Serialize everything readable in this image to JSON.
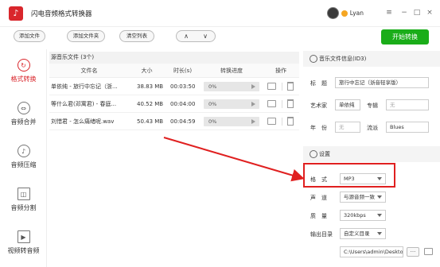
{
  "app": {
    "title": "闪电音频格式转换器",
    "logo_icon": "music-note-icon"
  },
  "user": {
    "name": "Lyan"
  },
  "window_controls": {
    "menu": "≡",
    "minimize": "−",
    "maximize": "□",
    "close": "×"
  },
  "toolbar": {
    "add_file": "添加文件",
    "add_folder": "添加文件夹",
    "clear_list": "清空列表",
    "up": "∧",
    "down": "∨",
    "start": "开始转换"
  },
  "sidebar": {
    "items": [
      {
        "label": "格式转换",
        "icon": "convert-icon",
        "glyph": "↻",
        "active": true
      },
      {
        "label": "音频合并",
        "icon": "merge-icon",
        "glyph": "⇔",
        "active": false
      },
      {
        "label": "音频压缩",
        "icon": "compress-icon",
        "glyph": "♪",
        "active": false
      },
      {
        "label": "音频分割",
        "icon": "split-icon",
        "glyph": "◫",
        "active": false
      },
      {
        "label": "视频转音频",
        "icon": "video-icon",
        "glyph": "▶",
        "active": false
      }
    ]
  },
  "filelist": {
    "header": "源音乐文件 (3个)",
    "columns": {
      "name": "文件名",
      "size": "大小",
      "duration": "时长(s)",
      "progress": "转换进度",
      "action": "操作"
    },
    "rows": [
      {
        "name": "单依纯 - 旅行中忘记（浙...",
        "size": "38.83 MB",
        "duration": "00:03:50",
        "progress": "0%"
      },
      {
        "name": "等什么君(邓寓君) - 春庭...",
        "size": "40.52 MB",
        "duration": "00:04:00",
        "progress": "0%"
      },
      {
        "name": "刘惜君 - 怎么痛绪呢.wav",
        "size": "50.43 MB",
        "duration": "00:04:59",
        "progress": "0%"
      }
    ]
  },
  "id3": {
    "section_title": "音乐文件信息(ID3)",
    "title_label": "标　题",
    "title_value": "旅行中忘记（浙音轻享版）",
    "artist_label": "艺术家",
    "artist_value": "单依纯",
    "album_label": "专辑",
    "album_value": "无",
    "year_label": "年　份",
    "year_value": "无",
    "genre_label": "流派",
    "genre_value": "Blues"
  },
  "settings": {
    "section_title": "设置",
    "format_label": "格　式",
    "format_value": "MP3",
    "channel_label": "声　道",
    "channel_value": "与源音频一致",
    "quality_label": "质　量",
    "quality_value": "320kbps",
    "output_label": "输出目录",
    "output_value": "自定义目录",
    "path_value": "C:\\Users\\admin\\Deskto",
    "more_button": "···"
  },
  "colors": {
    "brand_red": "#d9262c",
    "start_green": "#1aad19",
    "annotation_red": "#e02020"
  }
}
